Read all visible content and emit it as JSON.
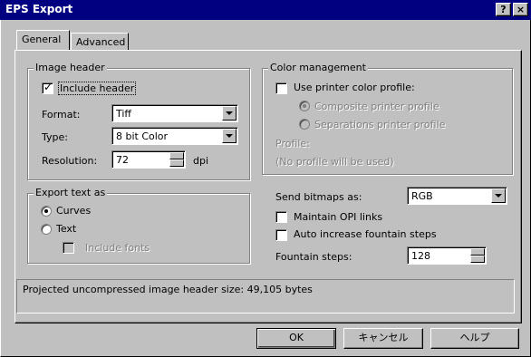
{
  "window": {
    "title": "EPS Export",
    "help_btn": "?",
    "close_btn": "×"
  },
  "tabs": [
    {
      "label": "General",
      "active": true
    },
    {
      "label": "Advanced",
      "active": false
    }
  ],
  "image_header": {
    "group_title": "Image header",
    "include_header": {
      "label": "Include header",
      "checked": true
    },
    "format": {
      "label": "Format:",
      "value": "Tiff"
    },
    "type": {
      "label": "Type:",
      "value": "8 bit Color"
    },
    "resolution": {
      "label": "Resolution:",
      "value": "72",
      "unit": "dpi"
    }
  },
  "export_text": {
    "group_title": "Export text as",
    "curves": {
      "label": "Curves",
      "selected": true
    },
    "text": {
      "label": "Text",
      "selected": false
    },
    "include_fonts": {
      "label": "Include fonts",
      "checked": false,
      "enabled": false
    }
  },
  "color_management": {
    "group_title": "Color management",
    "use_printer_profile": {
      "label": "Use printer color profile:",
      "checked": false
    },
    "composite": {
      "label": "Composite printer profile",
      "selected": true,
      "enabled": false
    },
    "separations": {
      "label": "Separations printer profile",
      "selected": false,
      "enabled": false
    },
    "profile_label": "Profile:",
    "profile_value": "(No profile will be used)"
  },
  "bitmaps": {
    "send_label": "Send bitmaps as:",
    "send_value": "RGB",
    "maintain_opi": {
      "label": "Maintain OPI links",
      "checked": false
    },
    "auto_increase": {
      "label": "Auto increase fountain steps",
      "checked": false
    },
    "fountain_steps": {
      "label": "Fountain steps:",
      "value": "128"
    }
  },
  "status": "Projected uncompressed image header size: 49,105 bytes",
  "buttons": {
    "ok": "OK",
    "cancel": "キャンセル",
    "help": "ヘルプ"
  },
  "colors": {
    "titlebar": "#000080",
    "face": "#c0c0c0",
    "disabled_text": "#808080"
  }
}
